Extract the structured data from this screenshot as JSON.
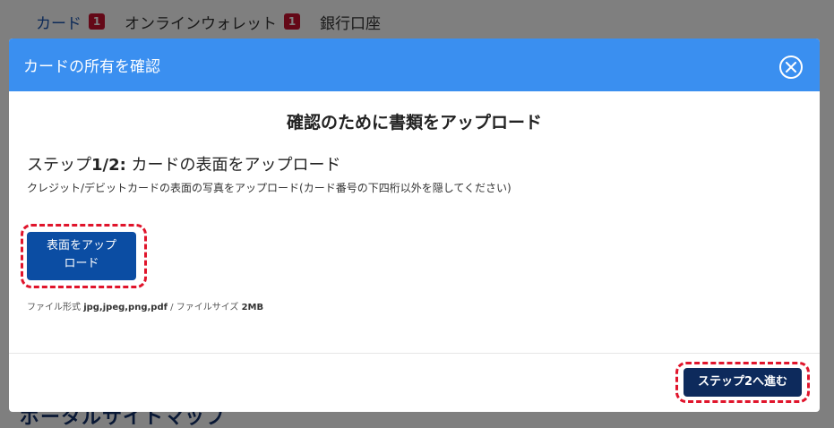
{
  "background": {
    "tabs": [
      {
        "label": "カード",
        "badge": "1"
      },
      {
        "label": "オンラインウォレット",
        "badge": "1"
      },
      {
        "label": "銀行口座",
        "badge": ""
      }
    ],
    "footer_heading": "ポータルサイトマップ"
  },
  "modal": {
    "title": "カードの所有を確認",
    "heading": "確認のために書類をアップロード",
    "step_prefix": "ステップ",
    "step_number": "1/2:",
    "step_text": " カードの表面をアップロード",
    "description": "クレジット/デビットカードの表面の写真をアップロード(カード番号の下四桁以外を隠してください)",
    "upload_button_line1": "表面をアップ",
    "upload_button_line2": "ロード",
    "file_info_label1": "ファイル形式 ",
    "file_info_formats": "jpg,jpeg,png,pdf",
    "file_info_label2": " / ファイルサイズ ",
    "file_info_size": "2MB",
    "next_button": "ステップ2へ進む"
  },
  "colors": {
    "header": "#3a8ff0",
    "upload_button": "#0b4da3",
    "next_button": "#0d2a5c",
    "highlight": "#e0142b",
    "badge": "#c8102e"
  }
}
